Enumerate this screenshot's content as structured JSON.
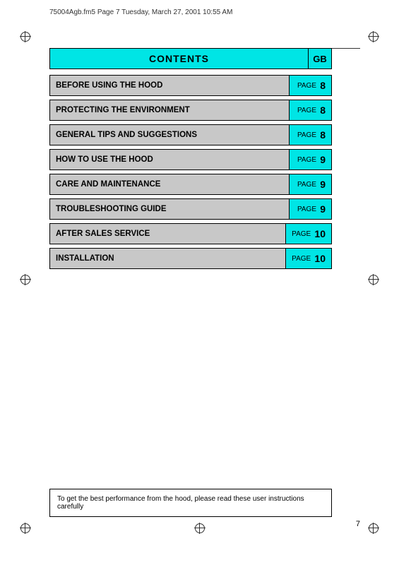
{
  "file_info": {
    "text": "75004Agb.fm5  Page 7  Tuesday, March 27, 2001  10:55 AM"
  },
  "header": {
    "title": "CONTENTS",
    "gb_label": "GB"
  },
  "toc": {
    "items": [
      {
        "label": "BEFORE USING THE HOOD",
        "page_word": "PAGE",
        "page_num": "8"
      },
      {
        "label": "PROTECTING THE ENVIRONMENT",
        "page_word": "PAGE",
        "page_num": "8"
      },
      {
        "label": "GENERAL TIPS AND SUGGESTIONS",
        "page_word": "PAGE",
        "page_num": "8"
      },
      {
        "label": "HOW TO USE THE HOOD",
        "page_word": "PAGE",
        "page_num": "9"
      },
      {
        "label": "CARE AND MAINTENANCE",
        "page_word": "PAGE",
        "page_num": "9"
      },
      {
        "label": "TROUBLESHOOTING GUIDE",
        "page_word": "PAGE",
        "page_num": "9"
      },
      {
        "label": "AFTER SALES SERVICE",
        "page_word": "PAGE",
        "page_num": "10"
      },
      {
        "label": "INSTALLATION",
        "page_word": "PAGE",
        "page_num": "10"
      }
    ]
  },
  "bottom_note": {
    "text": "To get the best performance from the hood, please read these user instructions carefully"
  },
  "page_number": "7"
}
